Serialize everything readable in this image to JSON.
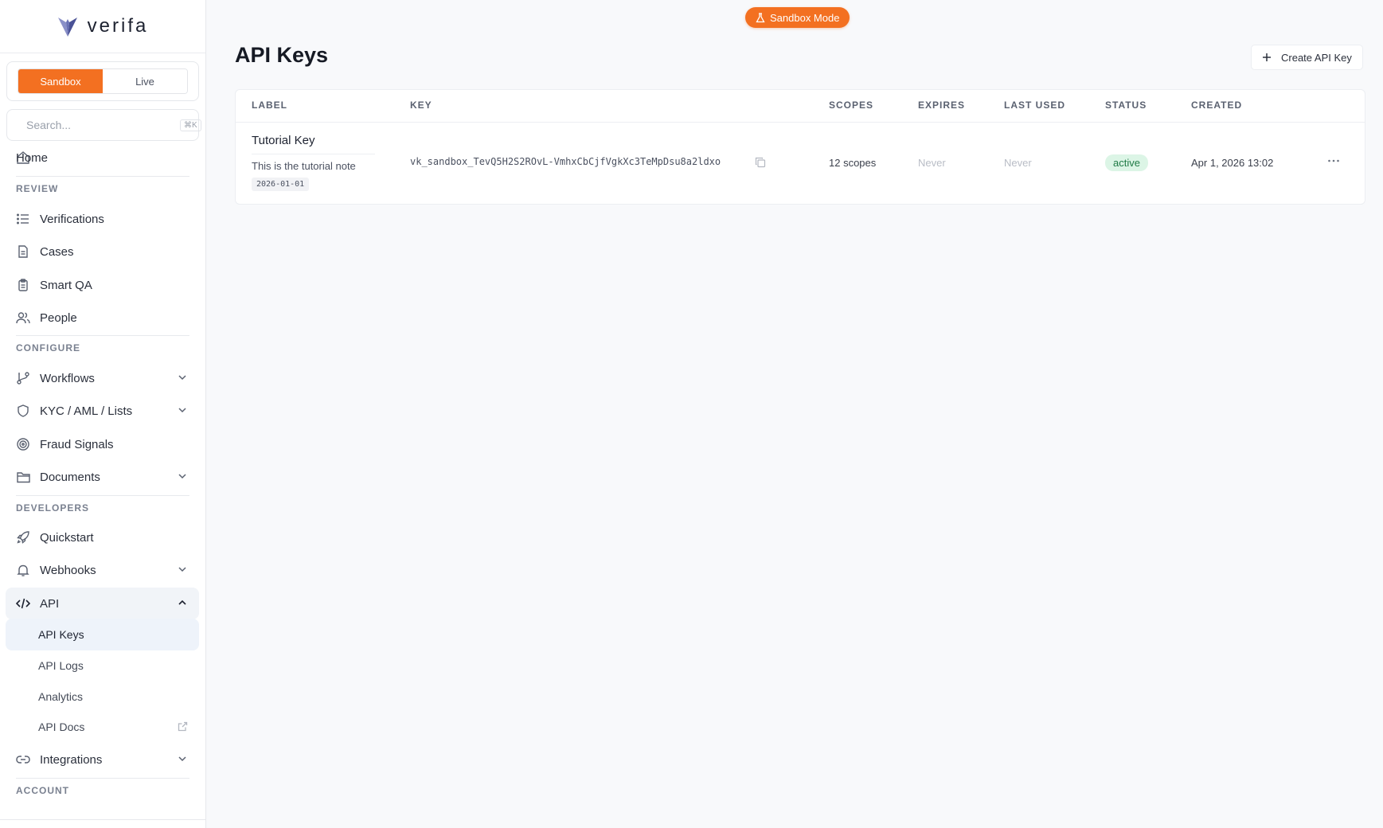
{
  "badge": {
    "label": "Sandbox Mode"
  },
  "brand": {
    "name": "verifa"
  },
  "env": {
    "options": [
      "Sandbox",
      "Live"
    ],
    "selected": "Sandbox"
  },
  "search": {
    "placeholder": "Search...",
    "shortcut": "⌘K"
  },
  "sidebar": {
    "home": "Home",
    "sections": {
      "review": "REVIEW",
      "configure": "CONFIGURE",
      "developers": "DEVELOPERS",
      "account": "ACCOUNT"
    },
    "review_items": [
      "Verifications",
      "Cases",
      "Smart QA",
      "People"
    ],
    "configure_items": [
      "Workflows",
      "KYC / AML / Lists",
      "Fraud Signals",
      "Documents"
    ],
    "developer_items": [
      "Quickstart",
      "Webhooks",
      "API"
    ],
    "api_sub_items": [
      "API Keys",
      "API Logs",
      "Analytics",
      "API Docs"
    ],
    "active_sub_item": "API Keys",
    "integrations": "Integrations"
  },
  "page": {
    "title": "API Keys",
    "create_button": "Create API Key"
  },
  "table": {
    "columns": [
      "LABEL",
      "KEY",
      "SCOPES",
      "EXPIRES",
      "LAST USED",
      "STATUS",
      "CREATED"
    ],
    "rows": [
      {
        "label": "Tutorial Key",
        "note": "This is the tutorial note",
        "date": "2026-01-01",
        "key": "vk_sandbox_TevQ5H2S2ROvL-VmhxCbCjfVgkXc3TeMpDsu8a2ldxo",
        "scopes": "12 scopes",
        "expires": "Never",
        "last_used": "Never",
        "status": "active",
        "created": "Apr 1, 2026 13:02"
      }
    ]
  },
  "colors": {
    "accent": "#f37021",
    "status_active_bg": "#dcf5e6",
    "status_active_fg": "#1f7a45"
  }
}
